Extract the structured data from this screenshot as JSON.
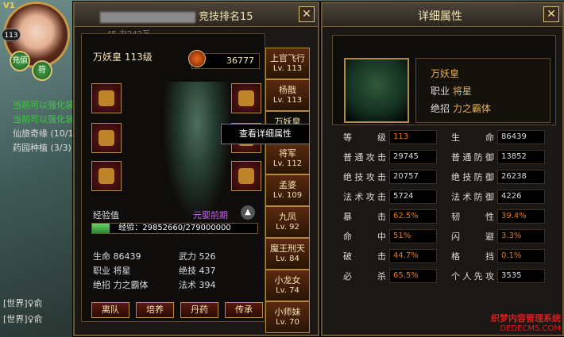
{
  "left_hud": {
    "vip": "V1",
    "level": "113",
    "recharge_label": "充值",
    "rune_label": "符",
    "quests": [
      {
        "text": "当前可以强化装",
        "color": "#38d038"
      },
      {
        "text": "当前可以强化装",
        "color": "#38d038"
      },
      {
        "text": "仙旅奇缘 (10/1",
        "color": "#dddddd"
      },
      {
        "text": "药园种植 (3/3)",
        "color": "#dddddd"
      }
    ],
    "chat": [
      {
        "channel": "[世界]",
        "text": "♀俞"
      },
      {
        "channel": "[世界]",
        "text": "♀俞"
      }
    ],
    "bottom_text": "公布 s22:1陆10"
  },
  "char_window": {
    "rank_title": "竞技排名15",
    "under_title": "45      力242万",
    "name": "万妖皇 113级",
    "power": "36777",
    "exp_label": "经验值",
    "stage": "元婴前期",
    "exp_text": "经验：29852660/279000000",
    "exp_current": 29852660,
    "exp_max": 279000000,
    "stats": [
      [
        {
          "label": "生命",
          "value": "86439"
        },
        {
          "label": "武力",
          "value": "526"
        }
      ],
      [
        {
          "label": "职业",
          "value": "将星"
        },
        {
          "label": "绝技",
          "value": "437"
        }
      ],
      [
        {
          "label": "绝招",
          "value": "力之霸体"
        },
        {
          "label": "法术",
          "value": "394"
        }
      ]
    ],
    "actions": [
      "离队",
      "培养",
      "丹药",
      "传承"
    ],
    "roster": [
      {
        "name": "上官飞行",
        "level": "Lv. 113"
      },
      {
        "name": "杨戬",
        "level": "Lv. 113"
      },
      {
        "name": "万妖皇",
        "level": "Lv. 113"
      },
      {
        "name": "将军",
        "level": "Lv. 112"
      },
      {
        "name": "孟婆",
        "level": "Lv. 109"
      },
      {
        "name": "九凤",
        "level": "Lv. 92"
      },
      {
        "name": "魔王刑天",
        "level": "Lv. 84"
      },
      {
        "name": "小龙女",
        "level": "Lv. 74"
      },
      {
        "name": "小师妹",
        "level": "Lv. 70"
      }
    ],
    "tooltip": "查看详细属性"
  },
  "detail_window": {
    "title": "详细属性",
    "name": "万妖皇",
    "job_label": "职业",
    "job_value": "将星",
    "skill_label": "绝招",
    "skill_value": "力之霸体",
    "attrs": [
      [
        {
          "label": "等级",
          "value": "113",
          "color": "#e87a1a"
        },
        {
          "label": "生命",
          "value": "86439",
          "color": "#dddddd"
        }
      ],
      [
        {
          "label": "普通攻击",
          "value": "29745",
          "color": "#dddddd"
        },
        {
          "label": "普通防御",
          "value": "13852",
          "color": "#dddddd"
        }
      ],
      [
        {
          "label": "绝技攻击",
          "value": "20757",
          "color": "#dddddd"
        },
        {
          "label": "绝技防御",
          "value": "26238",
          "color": "#dddddd"
        }
      ],
      [
        {
          "label": "法术攻击",
          "value": "5724",
          "color": "#dddddd"
        },
        {
          "label": "法术防御",
          "value": "4226",
          "color": "#dddddd"
        }
      ],
      [
        {
          "label": "暴击",
          "value": "62.5%",
          "color": "#e87a1a"
        },
        {
          "label": "韧性",
          "value": "39.4%",
          "color": "#e87a1a"
        }
      ],
      [
        {
          "label": "命中",
          "value": "51%",
          "color": "#e87a1a"
        },
        {
          "label": "闪避",
          "value": "3.3%",
          "color": "#e87a1a"
        }
      ],
      [
        {
          "label": "破击",
          "value": "44.7%",
          "color": "#e87a1a"
        },
        {
          "label": "格挡",
          "value": "0.1%",
          "color": "#e87a1a"
        }
      ],
      [
        {
          "label": "必杀",
          "value": "65.5%",
          "color": "#e87a1a"
        },
        {
          "label": "个人先攻",
          "value": "3535",
          "color": "#dddddd"
        }
      ]
    ]
  },
  "watermark": {
    "line1": "织梦内容管理系统",
    "line2": "DEDECMS.COM"
  }
}
